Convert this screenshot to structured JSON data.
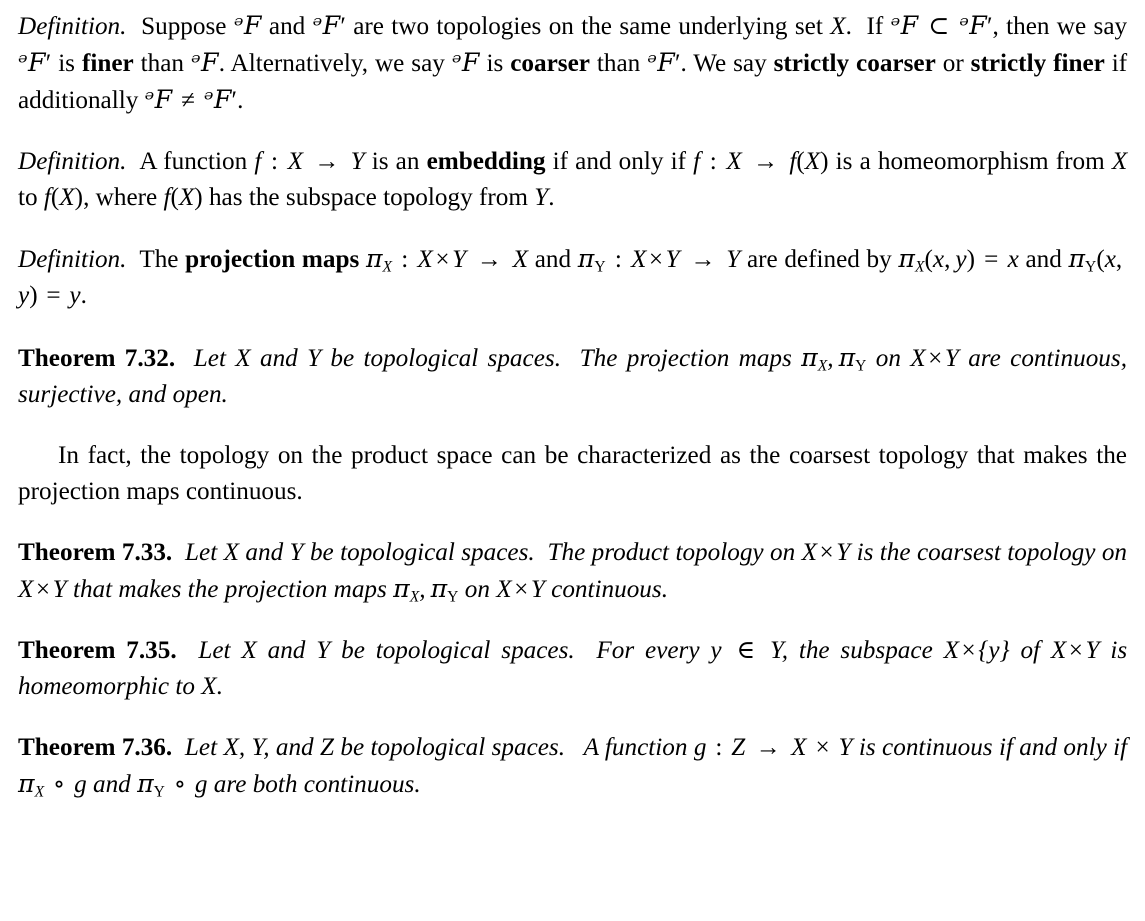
{
  "document": {
    "type": "mathematics-textbook-page",
    "subject": "Topology — product spaces and projection maps",
    "blocks": [
      {
        "id": "def-finer-coarser",
        "kind": "definition",
        "label": "Definition.",
        "text": "Suppose ᵊF and ᵊF′ are two topologies on the same underlying set X. If ᵊF ⊂ ᵊF′, then we say ᵊF′ is finer than ᵊF. Alternatively, we say ᵊF is coarser than ᵊF′. We say strictly coarser or strictly finer if additionally ᵊF ≠ ᵊF′.",
        "bold_terms": [
          "finer",
          "coarser",
          "strictly coarser",
          "strictly finer"
        ]
      },
      {
        "id": "def-embedding",
        "kind": "definition",
        "label": "Definition.",
        "text": "A function f : X → Y is an embedding if and only if f : X → f(X) is a homeomorphism from X to f(X), where f(X) has the subspace topology from Y.",
        "bold_terms": [
          "embedding"
        ]
      },
      {
        "id": "def-projection-maps",
        "kind": "definition",
        "label": "Definition.",
        "text": "The projection maps πX : X × Y → X and πY : X × Y → Y are defined by πX(x, y) = x and πY(x, y) = y.",
        "bold_terms": [
          "projection maps"
        ]
      },
      {
        "id": "thm-7-32",
        "kind": "theorem",
        "label": "Theorem 7.32.",
        "number": "7.32",
        "text": "Let X and Y be topological spaces. The projection maps πX, πY on X × Y are continuous, surjective, and open."
      },
      {
        "id": "para-in-fact",
        "kind": "paragraph",
        "indent": true,
        "text": "In fact, the topology on the product space can be characterized as the coarsest topology that makes the projection maps continuous."
      },
      {
        "id": "thm-7-33",
        "kind": "theorem",
        "label": "Theorem 7.33.",
        "number": "7.33",
        "text": "Let X and Y be topological spaces. The product topology on X × Y is the coarsest topology on X × Y that makes the projection maps πX, πY on X × Y continuous."
      },
      {
        "id": "thm-7-35",
        "kind": "theorem",
        "label": "Theorem 7.35.",
        "number": "7.35",
        "text": "Let X and Y be topological spaces. For every y ∈ Y, the subspace X × {y} of X × Y is homeomorphic to X."
      },
      {
        "id": "thm-7-36",
        "kind": "theorem",
        "label": "Theorem 7.36.",
        "number": "7.36",
        "text": "Let X, Y, and Z be topological spaces. A function g : Z → X × Y is continuous if and only if πX ∘ g and πY ∘ g are both continuous."
      }
    ]
  },
  "labels": {
    "definition": "Definition.",
    "theorem_7_32": "Theorem 7.32.",
    "theorem_7_33": "Theorem 7.33.",
    "theorem_7_35": "Theorem 7.35.",
    "theorem_7_36": "Theorem 7.36."
  },
  "terms": {
    "finer": "finer",
    "coarser": "coarser",
    "strictly_coarser": "strictly coarser",
    "strictly_finer": "strictly finer",
    "embedding": "embedding",
    "projection_maps": "projection maps"
  },
  "symbols": {
    "script_T": "ᵊF",
    "prime": "′",
    "subset": "⊂",
    "neq": "≠",
    "arrow": "→",
    "times": "×",
    "in": "∈",
    "circ": "∘",
    "pi": "π",
    "colon": ":",
    "equals": "=",
    "brace_open": "{",
    "brace_close": "}",
    "paren_open": "(",
    "paren_close": ")",
    "comma": ",",
    "period": "."
  },
  "variables": {
    "X": "X",
    "Y": "Y",
    "Z": "Z",
    "f": "f",
    "g": "g",
    "x": "x",
    "y": "y"
  },
  "fragments": {
    "d1_suppose": "Suppose",
    "d1_and": "and",
    "d1_are_two": "are two topologies on the same underlying set",
    "d1_if": "If",
    "d1_then_we_say": ", then we say",
    "d1_is": "is",
    "d1_than": "than",
    "d1_alternatively": ". Alternatively, we say",
    "d1_we_say": "We say",
    "d1_or": "or",
    "d1_if_additionally": "if additionally",
    "d2_a_function": "A function",
    "d2_is_an": "is an",
    "d2_iff": "if and only if",
    "d2_is_a": "is a",
    "d2_homeo_from": "homeomorphism from",
    "d2_to": "to",
    "d2_where": ", where",
    "d2_has_subspace": "has the subspace topology from",
    "d3_the": "The",
    "d3_and": "and",
    "d3_are_defined_by": "are defined by",
    "d3_and2": "and",
    "t32_let": "Let",
    "t32_and": "and",
    "t32_be_spaces": "be topological spaces.",
    "t32_the_proj": "The projection maps",
    "t32_on": "on",
    "t32_are_cont": "are continuous, surjective, and open.",
    "p_in_fact": "In fact, the topology on the product space can be characterized as the coarsest topology that makes the projection maps continuous.",
    "t33_the_product": "The product topology on",
    "t33_is_the": "is the coarsest topology on",
    "t33_that_makes": "that makes the projection maps",
    "t33_continuous": "continuous.",
    "t35_for_every": "For every",
    "t35_the_subspace": ", the subspace",
    "t35_of": "of",
    "t35_is_homeo": "is homeomorphic to",
    "t36_let": "Let",
    "t36_and_z": "and",
    "t36_be_spaces": "be topological spaces.",
    "t36_a_function": "A function",
    "t36_is_cont_iff": "is continuous if and only if",
    "t36_and": "and",
    "t36_both_cont": "are both continuous."
  },
  "style": {
    "background_color": "#ffffff",
    "text_color": "#000000",
    "body_font_size_px": 25,
    "line_height_px": 36
  }
}
